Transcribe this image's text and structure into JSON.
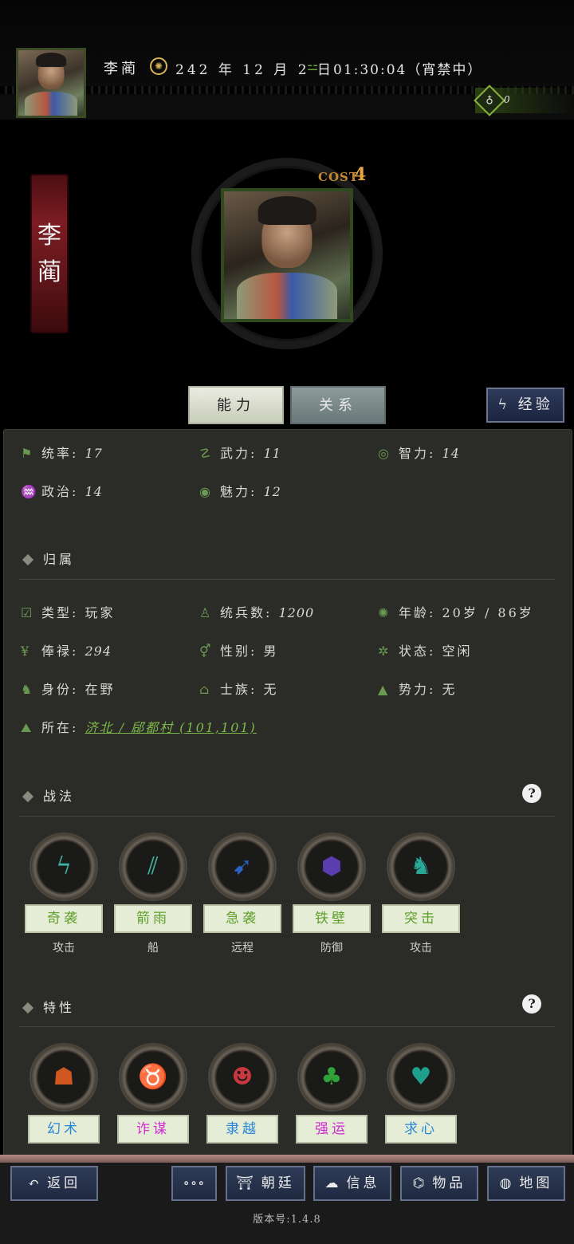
{
  "header": {
    "player_name": "李蔺",
    "date": "242 年 12 月 2 日",
    "time": "01:30:04（宵禁中）",
    "currency_value": "0"
  },
  "hero": {
    "name_top": "李",
    "name_bottom": "蔺",
    "cost_label": "COST",
    "cost_value": "4"
  },
  "tabs": {
    "ability": "能力",
    "relation": "关系",
    "experience": "经验"
  },
  "stats": {
    "command": {
      "label": "统率:",
      "value": "17"
    },
    "force": {
      "label": "武力:",
      "value": "11"
    },
    "intellect": {
      "label": "智力:",
      "value": "14"
    },
    "politics": {
      "label": "政治:",
      "value": "14"
    },
    "charm": {
      "label": "魅力:",
      "value": "12"
    }
  },
  "belong": {
    "title": "归属",
    "type": {
      "label": "类型:",
      "value": "玩家"
    },
    "troops": {
      "label": "统兵数:",
      "value": "1200"
    },
    "age": {
      "label": "年龄:",
      "value": "20岁 / 86岁"
    },
    "salary": {
      "label": "俸禄:",
      "value": "294"
    },
    "gender": {
      "label": "性别:",
      "value": "男"
    },
    "status": {
      "label": "状态:",
      "value": "空闲"
    },
    "identity": {
      "label": "身份:",
      "value": "在野"
    },
    "clan": {
      "label": "士族:",
      "value": "无"
    },
    "faction": {
      "label": "势力:",
      "value": "无"
    },
    "location": {
      "label": "所在:",
      "value": "济北 / 郈都村 (101,101)"
    }
  },
  "tactics": {
    "title": "战法",
    "items": [
      {
        "name": "奇袭",
        "type": "攻击",
        "icon": "claw-slash-icon",
        "color": "#3fb6a4"
      },
      {
        "name": "箭雨",
        "type": "船",
        "icon": "arrow-rain-icon",
        "color": "#3fb6a4"
      },
      {
        "name": "急袭",
        "type": "远程",
        "icon": "bow-arrow-icon",
        "color": "#2a63c8"
      },
      {
        "name": "铁壁",
        "type": "防御",
        "icon": "shield-hex-icon",
        "color": "#5b3db0"
      },
      {
        "name": "突击",
        "type": "攻击",
        "icon": "charging-soldier-icon",
        "color": "#2aa897"
      }
    ]
  },
  "traits": {
    "title": "特性",
    "items": [
      {
        "name": "幻术",
        "icon": "hooded-mage-icon",
        "color": "#d0561f",
        "label_color": "#2a86d6"
      },
      {
        "name": "诈谋",
        "icon": "fox-mask-icon",
        "color": "#a0602c",
        "label_color": "#d02ad0"
      },
      {
        "name": "隶越",
        "icon": "demon-face-icon",
        "color": "#c8383d",
        "label_color": "#2a86d6"
      },
      {
        "name": "强运",
        "icon": "clover-pattern-icon",
        "color": "#2fa33a",
        "label_color": "#d02ad0"
      },
      {
        "name": "求心",
        "icon": "heart-spade-icon",
        "color": "#1f9f8d",
        "label_color": "#2a86d6"
      }
    ]
  },
  "bottom_bar": {
    "back": "返回",
    "more": "∘∘∘",
    "court": "朝廷",
    "info": "信息",
    "items": "物品",
    "map": "地图",
    "version": "版本号:1.4.8"
  },
  "colors": {
    "accent_green": "#7fb84a",
    "panel_bg": "#2b2b27",
    "button_blue": "#2f3b57"
  }
}
